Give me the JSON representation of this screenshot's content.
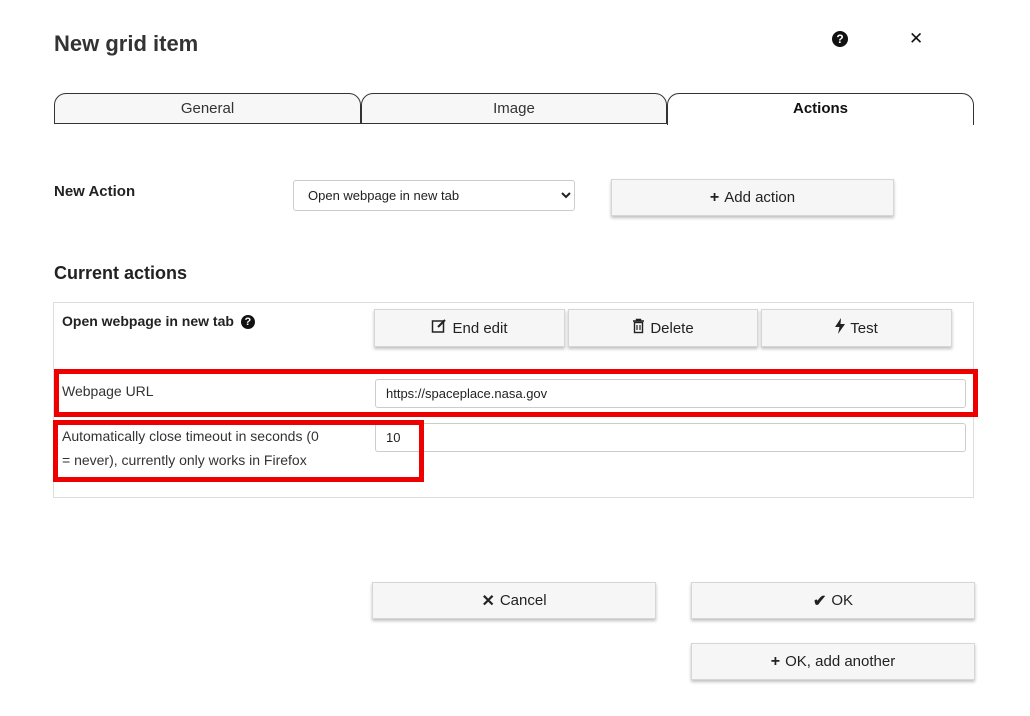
{
  "dialog": {
    "title": "New grid item",
    "help_icon": "question-circle-icon",
    "close_icon": "close-icon"
  },
  "tabs": [
    {
      "label": "General",
      "active": false
    },
    {
      "label": "Image",
      "active": false
    },
    {
      "label": "Actions",
      "active": true
    }
  ],
  "new_action": {
    "label": "New Action",
    "selected": "Open webpage in new tab",
    "add_button": "Add action"
  },
  "current_actions": {
    "title": "Current actions",
    "action_name": "Open webpage in new tab",
    "end_edit": "End edit",
    "delete": "Delete",
    "test": "Test",
    "fields": {
      "url_label": "Webpage URL",
      "url_value": "https://spaceplace.nasa.gov",
      "timeout_label_line1": "Automatically close timeout in seconds (0",
      "timeout_label_line2": "= never), currently only works in Firefox",
      "timeout_value": "10"
    }
  },
  "footer": {
    "cancel": "Cancel",
    "ok": "OK",
    "ok_add_another": "OK, add another"
  },
  "colors": {
    "highlight": "#ee0000",
    "button_bg": "#f6f6f6"
  }
}
